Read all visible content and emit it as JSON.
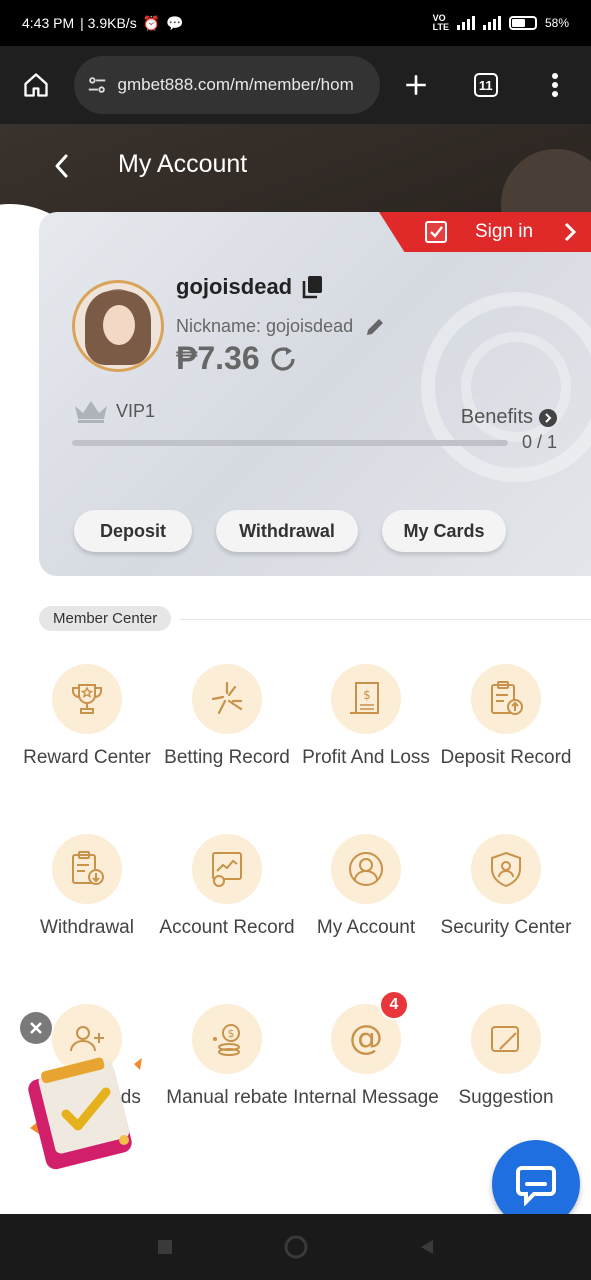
{
  "status_bar": {
    "time": "4:43 PM",
    "speed": "| 3.9KB/s",
    "battery": "58%",
    "battery_level": 0.58
  },
  "browser": {
    "url": "gmbet888.com/m/member/hom",
    "tab_count": "11"
  },
  "header": {
    "title": "My Account"
  },
  "card": {
    "sign_in_label": "Sign in",
    "username": "gojoisdead",
    "nickname": "Nickname: gojoisdead",
    "balance": "₱7.36",
    "vip_level": "VIP1",
    "benefits_label": "Benefits",
    "progress_text": "0 / 1",
    "progress_fraction": 0,
    "buttons": {
      "deposit": "Deposit",
      "withdrawal": "Withdrawal",
      "my_cards": "My Cards"
    }
  },
  "member_center": {
    "title": "Member Center",
    "items": [
      {
        "label": "Reward Center",
        "icon": "trophy-icon"
      },
      {
        "label": "Betting Record",
        "icon": "betting-record-icon"
      },
      {
        "label": "Profit And Loss",
        "icon": "receipt-icon"
      },
      {
        "label": "Deposit Record",
        "icon": "deposit-record-icon"
      },
      {
        "label": "Withdrawal",
        "icon": "withdrawal-record-icon"
      },
      {
        "label": "Account Record",
        "icon": "account-record-icon"
      },
      {
        "label": "My Account",
        "icon": "user-icon"
      },
      {
        "label": "Security Center",
        "icon": "shield-user-icon"
      },
      {
        "label": "Invite friends",
        "icon": "invite-icon"
      },
      {
        "label": "Manual rebate",
        "icon": "coins-icon"
      },
      {
        "label": "Internal Message",
        "icon": "at-icon",
        "badge": "4"
      },
      {
        "label": "Suggestion",
        "icon": "suggestion-icon"
      }
    ]
  },
  "colors": {
    "accent_red": "#e02a2a",
    "chat_blue": "#1f6fe0",
    "gold": "#d9a35a",
    "icon_bg": "#fbedd6"
  }
}
